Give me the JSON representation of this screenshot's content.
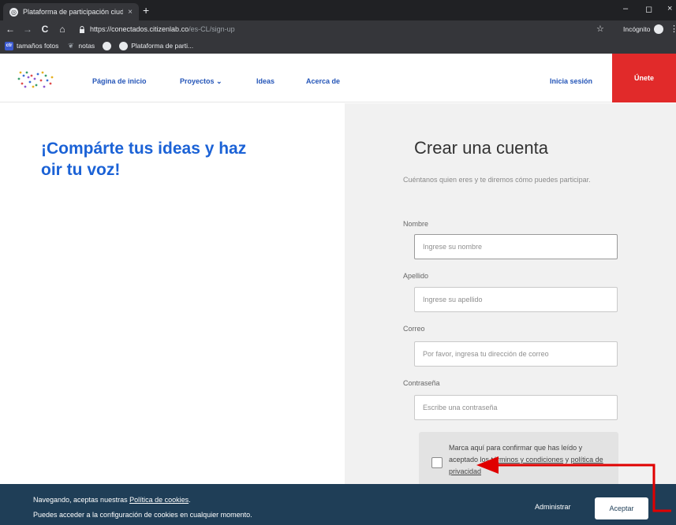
{
  "browser": {
    "tab_title": "Plataforma de participación ciud...",
    "tab_close": "×",
    "new_tab": "+",
    "window_controls": [
      "–",
      "◻",
      "×"
    ],
    "nav_buttons": [
      "←",
      "→",
      "C",
      "⌂"
    ],
    "url_host": "https://conectados.citizenlab.co",
    "url_path": "/es-CL/sign-up",
    "star_icon": "☆",
    "incognito_label": "Incógnito",
    "kebab": "⋮",
    "bookmarks": [
      {
        "label": "tamaños fotos",
        "icon": "ctr",
        "icon_color": "#3c5bd1"
      },
      {
        "label": "notas",
        "icon": "leaf",
        "icon_color": "#6d6d6d"
      },
      {
        "label": "",
        "icon": "globe",
        "icon_color": "#e8eaed"
      },
      {
        "label": "Plataforma de parti...",
        "icon": "globe",
        "icon_color": "#e8eaed"
      }
    ]
  },
  "site_nav": {
    "links": [
      "Página de inicio",
      "Proyectos ⌄",
      "Ideas",
      "Acerca de"
    ],
    "signin": "Inicia sesión",
    "signup": "Únete"
  },
  "hero": {
    "title": "¡Compárte tus ideas y haz oir tu voz!"
  },
  "form": {
    "title": "Crear una cuenta",
    "subtitle": "Cuéntanos quien eres y te diremos cómo puedes participar.",
    "fields": [
      {
        "label": "Nombre",
        "placeholder": "Ingrese su nombre"
      },
      {
        "label": "Apellido",
        "placeholder": "Ingrese su apellido"
      },
      {
        "label": "Correo",
        "placeholder": "Por favor, ingresa tu dirección de correo"
      },
      {
        "label": "Contraseña",
        "placeholder": "Escribe una contraseña"
      }
    ],
    "consent": {
      "prefix": "Marca aquí para confirmar que has leído y aceptado los ",
      "terms_link": "términos y condiciones",
      "middle": " y ",
      "privacy_link": "política de privacidad"
    }
  },
  "cookie_banner": {
    "line1_prefix": "Navegando, aceptas nuestras ",
    "line1_link": "Política de cookies",
    "line1_suffix": ".",
    "line2": "Puedes acceder a la configuración de cookies en cualquier momento.",
    "manage": "Administrar",
    "accept": "Aceptar"
  },
  "colors": {
    "brand_blue": "#1b62d6",
    "nav_blue": "#2455b8",
    "signup_red": "#e12a2a",
    "cookie_bg": "#1f3e57",
    "annotation_arrow": "#e00000"
  }
}
